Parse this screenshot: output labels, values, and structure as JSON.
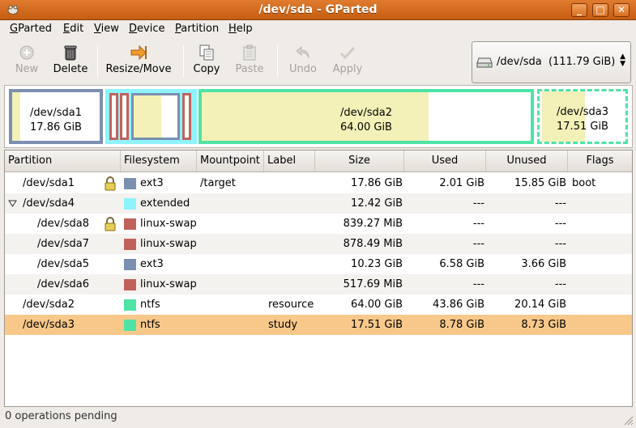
{
  "window": {
    "title": "/dev/sda - GParted"
  },
  "menu": [
    {
      "key": "G",
      "rest": "Parted"
    },
    {
      "key": "E",
      "rest": "dit"
    },
    {
      "key": "V",
      "rest": "iew"
    },
    {
      "key": "D",
      "rest": "evice"
    },
    {
      "key": "P",
      "rest": "artition"
    },
    {
      "key": "H",
      "rest": "elp"
    }
  ],
  "toolbar": {
    "new": "New",
    "delete": "Delete",
    "resize": "Resize/Move",
    "copy": "Copy",
    "paste": "Paste",
    "undo": "Undo",
    "apply": "Apply"
  },
  "device": {
    "name": "/dev/sda",
    "size": "(111.79 GiB)"
  },
  "graph": {
    "sda1": {
      "name": "/dev/sda1",
      "size": "17.86 GiB"
    },
    "sda2": {
      "name": "/dev/sda2",
      "size": "64.00 GiB"
    },
    "sda3": {
      "name": "/dev/sda3",
      "size": "17.51 GiB"
    }
  },
  "columns": {
    "partition": "Partition",
    "filesystem": "Filesystem",
    "mountpoint": "Mountpoint",
    "label": "Label",
    "size": "Size",
    "used": "Used",
    "unused": "Unused",
    "flags": "Flags"
  },
  "rows": [
    {
      "partition": "/dev/sda1",
      "fs": "ext3",
      "mount": "/target",
      "label": "",
      "size": "17.86 GiB",
      "used": "2.01 GiB",
      "unused": "15.85 GiB",
      "flags": "boot",
      "color": "#7b8fb0"
    },
    {
      "partition": "/dev/sda4",
      "fs": "extended",
      "mount": "",
      "label": "",
      "size": "12.42 GiB",
      "used": "---",
      "unused": "---",
      "flags": "",
      "color": "#8ef3fb"
    },
    {
      "partition": "/dev/sda8",
      "fs": "linux-swap",
      "mount": "",
      "label": "",
      "size": "839.27 MiB",
      "used": "---",
      "unused": "---",
      "flags": "",
      "color": "#c0625c"
    },
    {
      "partition": "/dev/sda7",
      "fs": "linux-swap",
      "mount": "",
      "label": "",
      "size": "878.49 MiB",
      "used": "---",
      "unused": "---",
      "flags": "",
      "color": "#c0625c"
    },
    {
      "partition": "/dev/sda5",
      "fs": "ext3",
      "mount": "",
      "label": "",
      "size": "10.23 GiB",
      "used": "6.58 GiB",
      "unused": "3.66 GiB",
      "flags": "",
      "color": "#7b8fb0"
    },
    {
      "partition": "/dev/sda6",
      "fs": "linux-swap",
      "mount": "",
      "label": "",
      "size": "517.69 MiB",
      "used": "---",
      "unused": "---",
      "flags": "",
      "color": "#c0625c"
    },
    {
      "partition": "/dev/sda2",
      "fs": "ntfs",
      "mount": "",
      "label": "resource",
      "size": "64.00 GiB",
      "used": "43.86 GiB",
      "unused": "20.14 GiB",
      "flags": "",
      "color": "#4fe3a6"
    },
    {
      "partition": "/dev/sda3",
      "fs": "ntfs",
      "mount": "",
      "label": "study",
      "size": "17.51 GiB",
      "used": "8.78 GiB",
      "unused": "8.73 GiB",
      "flags": "",
      "color": "#4fe3a6"
    }
  ],
  "status": {
    "text": "0 operations pending"
  }
}
